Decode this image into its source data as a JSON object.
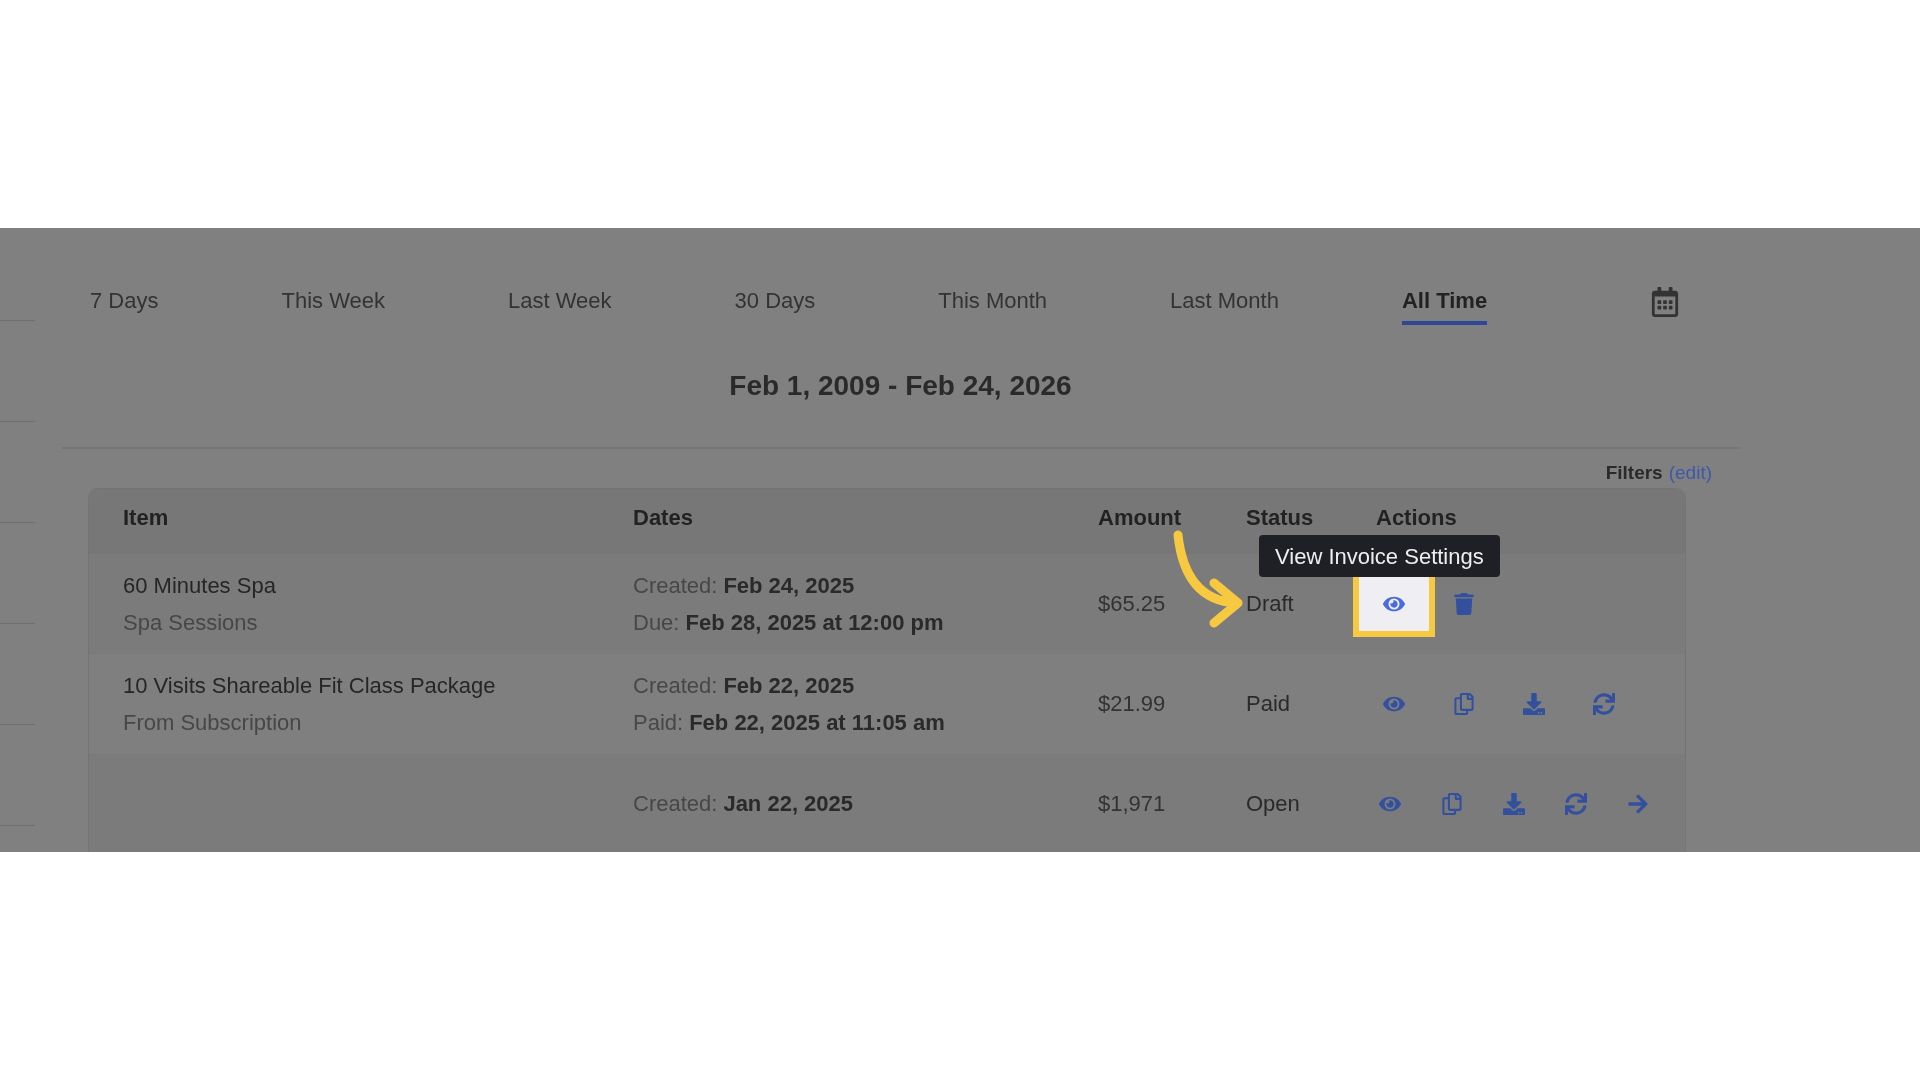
{
  "tabs": [
    {
      "label": "7 Days",
      "selected": false
    },
    {
      "label": "This Week",
      "selected": false
    },
    {
      "label": "Last Week",
      "selected": false
    },
    {
      "label": "30 Days",
      "selected": false
    },
    {
      "label": "This Month",
      "selected": false
    },
    {
      "label": "Last Month",
      "selected": false
    },
    {
      "label": "All Time",
      "selected": true
    }
  ],
  "date_range": "Feb 1, 2009 - Feb 24, 2026",
  "filters": {
    "label": "Filters",
    "link": "(edit)"
  },
  "table": {
    "columns": [
      "Item",
      "Dates",
      "Amount",
      "Status",
      "Actions"
    ],
    "rows": [
      {
        "item": "60 Minutes Spa",
        "subtitle": "Spa Sessions",
        "dates": [
          {
            "label": "Created:",
            "value": "Feb 24, 2025"
          },
          {
            "label": "Due:",
            "value": "Feb 28, 2025 at 12:00 pm"
          }
        ],
        "amount": "$65.25",
        "status": "Draft",
        "actions": [
          {
            "kind": "view",
            "highlighted": true
          },
          {
            "kind": "delete",
            "highlighted": false
          }
        ]
      },
      {
        "item": "10 Visits Shareable Fit Class Package",
        "subtitle": "From Subscription",
        "dates": [
          {
            "label": "Created:",
            "value": "Feb 22, 2025"
          },
          {
            "label": "Paid:",
            "value": "Feb 22, 2025 at 11:05 am"
          }
        ],
        "amount": "$21.99",
        "status": "Paid",
        "actions": [
          {
            "kind": "view",
            "highlighted": false
          },
          {
            "kind": "copy",
            "highlighted": false
          },
          {
            "kind": "download",
            "highlighted": false
          },
          {
            "kind": "refresh",
            "highlighted": false
          }
        ]
      },
      {
        "dates": [
          {
            "label": "Created:",
            "value": "Jan 22, 2025"
          }
        ],
        "amount": "$1,971",
        "status": "Open",
        "actions": [
          {
            "kind": "view",
            "highlighted": false
          },
          {
            "kind": "copy",
            "highlighted": false
          },
          {
            "kind": "download",
            "highlighted": false
          },
          {
            "kind": "refresh",
            "highlighted": false
          },
          {
            "kind": "forward",
            "highlighted": false
          }
        ]
      }
    ]
  },
  "tooltip": "View Invoice Settings"
}
